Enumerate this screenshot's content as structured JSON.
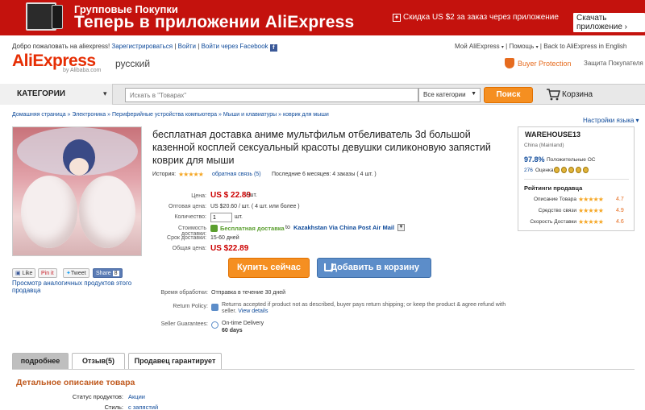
{
  "banner": {
    "line1": "Групповые Покупки",
    "line2": "Теперь в приложении AliExpress",
    "discount": "Скидка US $2 за заказ через приложение",
    "download": "Скачать приложение ›"
  },
  "header": {
    "welcome": "Добро пожаловать на aliexpress!",
    "register": "Зарегистрироваться",
    "login": "Войти",
    "login_fb": "Войти через Facebook",
    "my_ali": "Мой AliExpress",
    "help": "Помощь",
    "back_en": "Back to AliExpress in English",
    "logo": "AliExpress",
    "logo_sub": "by Alibaba.com",
    "language": "русский",
    "buyer_protection": "Buyer Protection",
    "buyer_protection_sub": "Защита Покупателя"
  },
  "nav": {
    "categories": "КАТЕГОРИИ",
    "search_placeholder": "Искать в \"Товарах\"",
    "all_categories": "Все категории",
    "search_btn": "Поиск",
    "cart": "Корзина"
  },
  "breadcrumb": [
    "Домашняя страница",
    "Электроника",
    "Периферийные устройства компьютера",
    "Мыши и клавиатуры",
    "коврик для мыши"
  ],
  "lang_settings": "Настройки языка ▾",
  "social": {
    "like": "Like",
    "pin": "Pin it",
    "tweet": "Tweet",
    "share": "Share",
    "share_count": "8"
  },
  "similar": "Просмотр аналогичных продуктов этого продавца",
  "product": {
    "title": "бесплатная доставка аниме мультфильм отбеливатель 3d большой казенной косплей сексуальный красоты девушки силиконовую запястий коврик для мыши",
    "history_lbl": "История:",
    "feedback": "обратная связь (5)",
    "orders": "Последние 6 месяцев: 4 заказы ( 4 шт. )",
    "price_lbl": "Цена:",
    "price": "US $ 22.89",
    "price_unit": "/ шт.",
    "wholesale_lbl": "Оптовая цена:",
    "wholesale": "US $20.60 / шт. ( 4 шт. или более )",
    "qty_lbl": "Количество:",
    "qty": "1",
    "qty_unit": "шт.",
    "ship_lbl": "Стоимость доставки:",
    "ship_free": "Бесплатная доставка",
    "ship_to": "to",
    "ship_method": "Kazakhstan Via China Post Air Mail",
    "delivery_lbl": "Срок доставки:",
    "delivery": "15-60 дней",
    "total_lbl": "Общая цена:",
    "total": "US $22.89",
    "buy_now": "Купить сейчас",
    "add_cart": "Добавить в корзину"
  },
  "extra": {
    "proc_lbl": "Время обработки:",
    "proc": "Отправка в течение 30 дней",
    "return_lbl": "Return Policy:",
    "return_text": "Returns accepted if product not as described, buyer pays return shipping; or keep the product & agree refund with seller.",
    "view_details": "View details",
    "guarantee_lbl": "Seller Guarantees:",
    "guarantee": "On-time Delivery",
    "guarantee_days": "60 days"
  },
  "seller": {
    "name": "WAREHOUSE13",
    "country": "China (Mainland)",
    "positive_pct": "97.8%",
    "positive_lbl": "Положительные ОС",
    "score": "276",
    "score_lbl": "Оценка",
    "ratings_title": "Рейтинги продавца",
    "ratings": [
      {
        "label": "Описание Товара",
        "value": "4.7"
      },
      {
        "label": "Средство связи",
        "value": "4.9"
      },
      {
        "label": "Скорость Доставки",
        "value": "4.6"
      }
    ]
  },
  "tabs": [
    "подробнее",
    "Отзыв(5)",
    "Продавец гарантирует"
  ],
  "details": {
    "heading": "Детальное описание товара",
    "rows": [
      {
        "key": "Статус продуктов:",
        "value": "Акции"
      },
      {
        "key": "Стиль:",
        "value": "с запястий"
      }
    ]
  },
  "colors": {
    "brand_red": "#c4120d",
    "orange": "#f58f21",
    "blue_btn": "#5c8dc9",
    "price_red": "#cc0000"
  }
}
